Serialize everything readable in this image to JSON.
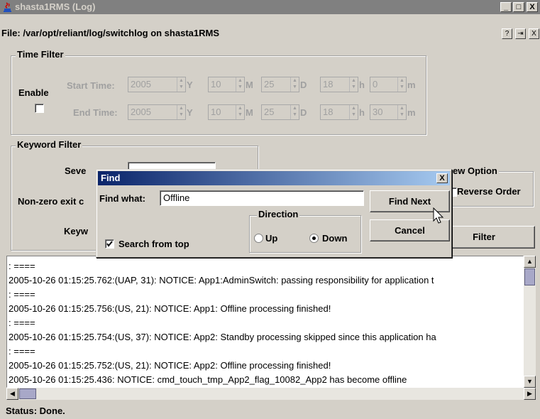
{
  "window": {
    "title": "shasta1RMS (Log)",
    "controls": {
      "minimize": "_",
      "maximize": "□",
      "close": "X"
    }
  },
  "file_info": "File: /var/opt/reliant/log/switchlog on shasta1RMS",
  "small_buttons": [
    "?",
    "⇥",
    "X"
  ],
  "time_filter": {
    "title": "Time Filter",
    "enable_label": "Enable",
    "enabled": false,
    "start_label": "Start Time:",
    "end_label": "End Time:",
    "start": {
      "year": "2005",
      "month": "10",
      "day": "25",
      "hour": "18",
      "minute": "0"
    },
    "end": {
      "year": "2005",
      "month": "10",
      "day": "25",
      "hour": "18",
      "minute": "30"
    },
    "units": {
      "year": "Y",
      "month": "M",
      "day": "D",
      "hour": "h",
      "minute": "m"
    }
  },
  "keyword_filter": {
    "title": "Keyword Filter",
    "severity_label": "Seve",
    "nonzero_label": "Non-zero exit c",
    "keyword_label": "Keyw"
  },
  "view_option": {
    "title": "ew Option",
    "reverse_label": "Reverse Order"
  },
  "filter_button": "Filter",
  "log_lines": [
    ": ====",
    "2005-10-26 01:15:25.762:(UAP, 31): NOTICE: App1:AdminSwitch: passing responsibility for application t",
    ": ====",
    "2005-10-26 01:15:25.756:(US, 21): NOTICE: App1: Offline processing finished!",
    ": ====",
    "2005-10-26 01:15:25.754:(US, 37): NOTICE: App2: Standby processing skipped since this application ha",
    ": ====",
    "2005-10-26 01:15:25.752:(US, 21): NOTICE: App2: Offline processing finished!",
    "2005-10-26 01:15:25.436: NOTICE: cmd_touch_tmp_App2_flag_10082_App2 has become offline"
  ],
  "status": "Status: Done.",
  "find_dialog": {
    "title": "Find",
    "close": "X",
    "find_what_label": "Find what:",
    "find_what_value": "Offline",
    "find_next": "Find Next",
    "cancel": "Cancel",
    "direction_label": "Direction",
    "up_label": "Up",
    "down_label": "Down",
    "direction": "down",
    "search_from_top_label": "Search from top",
    "search_from_top": true
  }
}
